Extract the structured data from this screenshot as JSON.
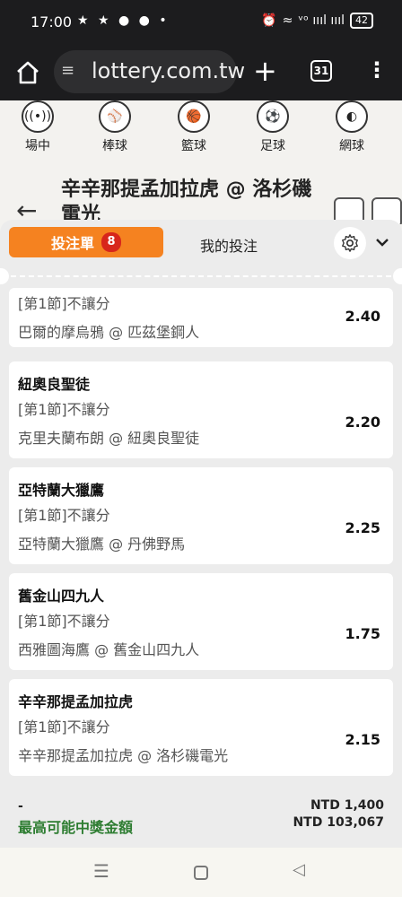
{
  "status_bar": {
    "time": "17:00",
    "notif_icons": "★ ★ ● ● •",
    "battery": "42",
    "signal": "ᵛᵒ ıııl ıııl"
  },
  "browser": {
    "url": "lottery.com.tw",
    "tab_count": "31",
    "site_icon": "≡",
    "plus": "+",
    "menu": "⋮"
  },
  "sports_nav": [
    {
      "label": "場中",
      "icon": "live-icon"
    },
    {
      "label": "棒球",
      "icon": "baseball-icon"
    },
    {
      "label": "籃球",
      "icon": "basketball-icon"
    },
    {
      "label": "足球",
      "icon": "soccer-icon"
    },
    {
      "label": "網球",
      "icon": "tennis-icon"
    }
  ],
  "match_header": {
    "title": "辛辛那提孟加拉虎 @ 洛杉磯電光",
    "back": "←"
  },
  "bet_slip": {
    "tab_betslip": "投注單",
    "count": "8",
    "tab_mybets": "我的投注",
    "collapse": "⌄",
    "bets": [
      {
        "team": "",
        "market": "[第1節]不讓分",
        "match": "巴爾的摩烏鴉 @ 匹茲堡鋼人",
        "odds": "2.40"
      },
      {
        "team": "紐奧良聖徒",
        "market": "[第1節]不讓分",
        "match": "克里夫蘭布朗 @ 紐奧良聖徒",
        "odds": "2.20"
      },
      {
        "team": "亞特蘭大獵鷹",
        "market": "[第1節]不讓分",
        "match": "亞特蘭大獵鷹 @ 丹佛野馬",
        "odds": "2.25"
      },
      {
        "team": "舊金山四九人",
        "market": "[第1節]不讓分",
        "match": "西雅圖海鷹 @ 舊金山四九人",
        "odds": "1.75"
      },
      {
        "team": "辛辛那提孟加拉虎",
        "market": "[第1節]不讓分",
        "match": "辛辛那提孟加拉虎 @ 洛杉磯電光",
        "odds": "2.15"
      }
    ],
    "summary": {
      "dash": "-",
      "stake": "NTD 1,400",
      "label": "最高可能中獎金額",
      "payout": "NTD 103,067"
    }
  },
  "android_nav": {
    "menu": "☰",
    "back": "◁"
  },
  "colors": {
    "accent": "#f58220",
    "badge": "#d7261b",
    "payout_label": "#2e7d32"
  }
}
